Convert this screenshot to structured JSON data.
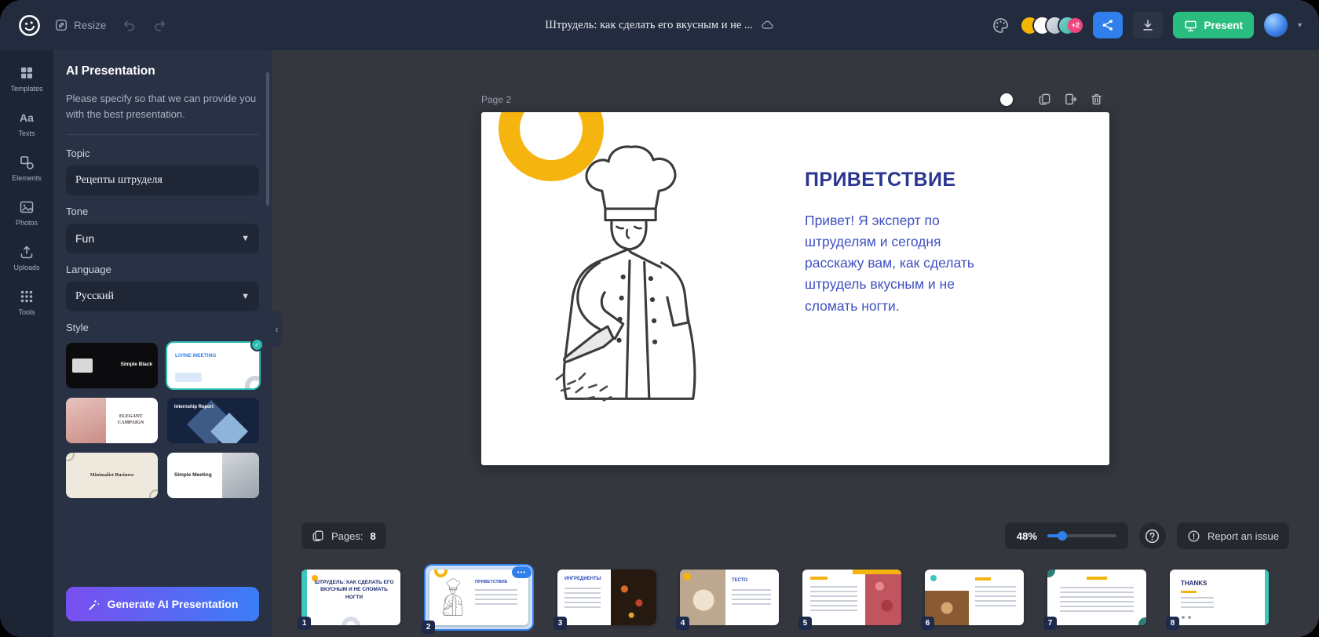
{
  "topbar": {
    "resize_label": "Resize",
    "doc_title": "Штрудель: как сделать его вкусным и не ...",
    "swatch_more": "+2",
    "present_label": "Present",
    "swatch_colors": [
      "#f2b705",
      "#ffffff",
      "#c3c9d2",
      "#49b8b2"
    ]
  },
  "rail": {
    "items": [
      {
        "label": "Templates"
      },
      {
        "label": "Texts"
      },
      {
        "label": "Elements"
      },
      {
        "label": "Photos"
      },
      {
        "label": "Uploads"
      },
      {
        "label": "Tools"
      }
    ]
  },
  "panel": {
    "title": "AI Presentation",
    "description": "Please specify so that we can provide you with the best presentation.",
    "topic_label": "Topic",
    "topic_value": "Рецепты штруделя",
    "tone_label": "Tone",
    "tone_value": "Fun",
    "language_label": "Language",
    "language_value": "Русский",
    "style_label": "Style",
    "styles": [
      {
        "name": "Simple Black",
        "selected": false
      },
      {
        "name": "LIVINE MEETING",
        "selected": true
      },
      {
        "name": "ELEGANT CAMPAIGN",
        "selected": false
      },
      {
        "name": "Internship Report",
        "selected": false
      },
      {
        "name": "Minimalist Business",
        "selected": false
      },
      {
        "name": "Simple Meeting",
        "selected": false
      }
    ],
    "generate_label": "Generate AI Presentation"
  },
  "canvas": {
    "page_label": "Page 2",
    "slide": {
      "heading": "ПРИВЕТСТВИЕ",
      "body": "Привет! Я эксперт по штруделям и сегодня расскажу вам, как сделать штрудель вкусным и не сломать ногти."
    }
  },
  "footer": {
    "pages_label": "Pages:",
    "pages_count": "8",
    "zoom_value": "48%",
    "report_label": "Report an issue"
  },
  "filmstrip": [
    {
      "num": "1",
      "title": "ШТРУДЕЛЬ: КАК СДЕЛАТЬ ЕГО ВКУСНЫМ И НЕ СЛОМАТЬ НОГТИ",
      "selected": false
    },
    {
      "num": "2",
      "title": "ПРИВЕТСТВИЕ",
      "selected": true
    },
    {
      "num": "3",
      "title": "ИНГРЕДИЕНТЫ",
      "selected": false
    },
    {
      "num": "4",
      "title": "ТЕСТО",
      "selected": false
    },
    {
      "num": "5",
      "title": "",
      "selected": false
    },
    {
      "num": "6",
      "title": "",
      "selected": false
    },
    {
      "num": "7",
      "title": "",
      "selected": false
    },
    {
      "num": "8",
      "title": "THANKS",
      "selected": false
    }
  ],
  "colors": {
    "accent_blue": "#2f80ed",
    "present_green": "#2abd80",
    "brand_yellow": "#f6b40e",
    "teal": "#3cc7bd",
    "slide_heading": "#2a3590",
    "slide_body": "#3f51c1"
  }
}
